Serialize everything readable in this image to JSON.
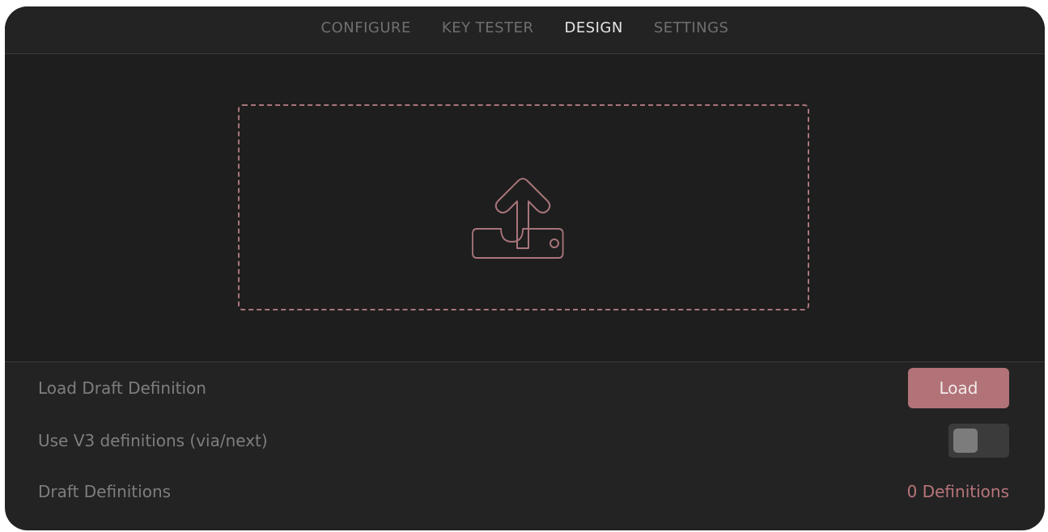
{
  "tabs": [
    {
      "label": "CONFIGURE",
      "active": false
    },
    {
      "label": "KEY TESTER",
      "active": false
    },
    {
      "label": "DESIGN",
      "active": true
    },
    {
      "label": "SETTINGS",
      "active": false
    }
  ],
  "dropzone": {
    "icon": "upload-icon"
  },
  "settings": {
    "load_draft": {
      "label": "Load Draft Definition",
      "button_label": "Load"
    },
    "use_v3": {
      "label": "Use V3 definitions (via/next)",
      "enabled": false
    },
    "draft_definitions": {
      "label": "Draft Definitions",
      "value": "0 Definitions"
    }
  },
  "colors": {
    "accent": "#b17378",
    "background": "#232323",
    "panel": "#1e1e1e"
  }
}
